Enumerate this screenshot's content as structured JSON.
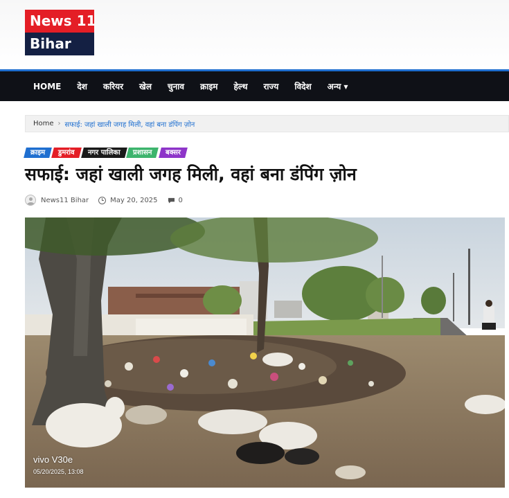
{
  "site": {
    "logo_line1": "News 11",
    "logo_line2": "Bihar"
  },
  "nav": {
    "items": [
      "HOME",
      "देश",
      "करियर",
      "खेल",
      "चुनाव",
      "क्राइम",
      "हेल्थ",
      "राज्य",
      "विदेश",
      "अन्य"
    ]
  },
  "breadcrumb": {
    "home": "Home",
    "current": "सफाई: जहां खाली जगह मिली, वहां बना डंपिंग ज़ोन"
  },
  "tags": [
    {
      "label": "क्राइम",
      "color": "#1f6fd0"
    },
    {
      "label": "डुमरांव",
      "color": "#e41e26"
    },
    {
      "label": "नगर पालिका",
      "color": "#1a1a1a"
    },
    {
      "label": "प्रशासन",
      "color": "#3db46d"
    },
    {
      "label": "बक्सर",
      "color": "#8e35c9"
    }
  ],
  "article": {
    "title": "सफाई: जहां खाली जगह मिली, वहां बना डंपिंग ज़ोन",
    "author": "News11 Bihar",
    "date": "May 20, 2025",
    "comments": "0"
  },
  "photo": {
    "watermark_model": "vivo V30e",
    "watermark_timestamp": "05/20/2025, 13:08"
  },
  "colors": {
    "nav_bg": "#0f1117",
    "nav_accent": "#1f6fd0",
    "logo_red": "#e41e26",
    "logo_navy": "#142043"
  }
}
